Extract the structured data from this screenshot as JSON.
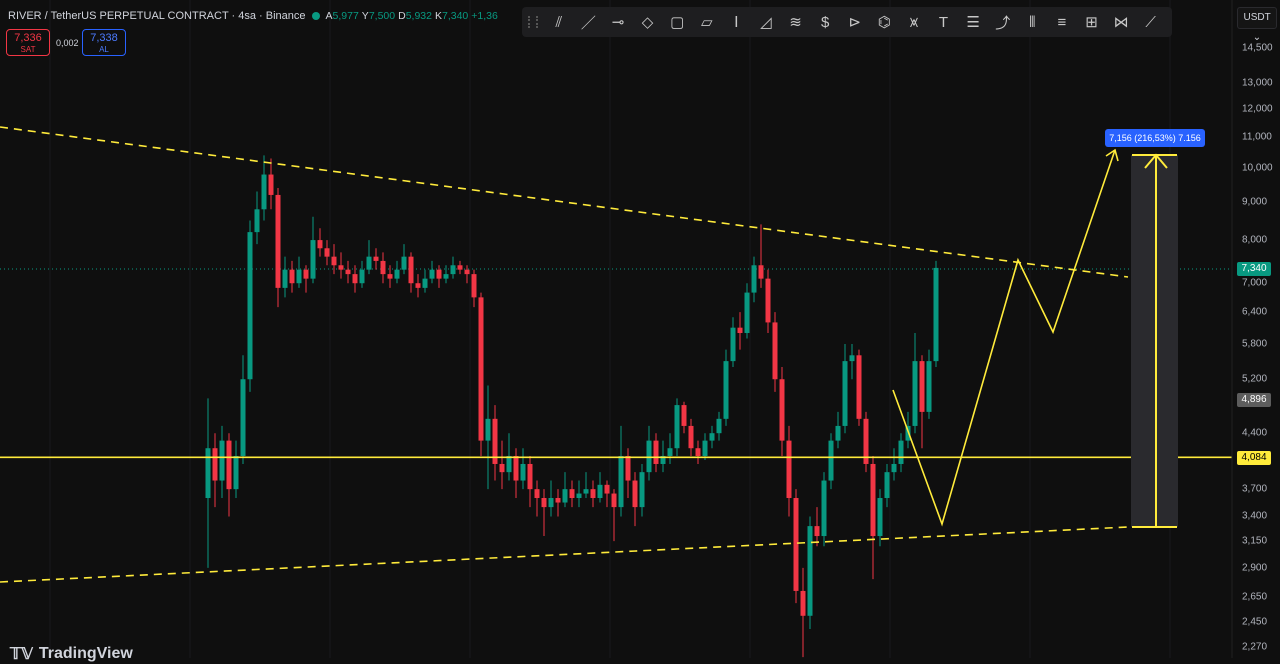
{
  "header": {
    "symbol": "RIVER / TetherUS PERPETUAL CONTRACT · 4sa · Binance",
    "ohlc": [
      {
        "k": "A",
        "v": "5,977"
      },
      {
        "k": "Y",
        "v": "7,500"
      },
      {
        "k": "D",
        "v": "5,932"
      },
      {
        "k": "K",
        "v": "7,340"
      }
    ],
    "change": "+1,36",
    "sell": {
      "price": "7,336",
      "label": "SAT"
    },
    "spread": "0,002",
    "buy": {
      "price": "7,338",
      "label": "AL"
    }
  },
  "toolbar": {
    "icons": [
      "trend-line-pair-icon",
      "trend-line-icon",
      "horizontal-ray-icon",
      "rotated-rectangle-icon",
      "rectangle-icon",
      "parallel-channel-icon",
      "price-range-icon",
      "triangle-icon",
      "fib-channel-icon",
      "price-label-icon",
      "pitchfork-icon",
      "path-icon",
      "head-shoulders-icon",
      "text-icon",
      "fib-retracement-icon",
      "polyline-arrow-icon",
      "bars-pattern-icon",
      "long-position-icon",
      "date-price-range-icon",
      "xabcd-pattern-icon",
      "brush-icon"
    ],
    "glyphs": [
      "⫽",
      "／",
      "⊸",
      "◇",
      "▢",
      "▱",
      "Ⅰ",
      "◿",
      "≋",
      "$",
      "⊳",
      "⌬",
      "⩙",
      "T",
      "☰",
      "⤴",
      "⦀",
      "≡",
      "⊞",
      "⋈",
      "⟋"
    ]
  },
  "price_axis": {
    "currency": "USDT",
    "ticks": [
      "14,500",
      "13,000",
      "12,000",
      "11,000",
      "10,000",
      "9,000",
      "8,000",
      "7,000",
      "6,400",
      "5,800",
      "5,200",
      "4,400",
      "3,700",
      "3,400",
      "3,150",
      "2,900",
      "2,650",
      "2,450",
      "2,270"
    ],
    "last_price": "7,340",
    "crosshair_price": "4,896",
    "line_price": "4,084"
  },
  "colors": {
    "up": "#089981",
    "down": "#f23645",
    "drawing": "#ffeb3b",
    "measure": "#2962ff",
    "background": "#0f0f0f"
  },
  "measure_label": "7,156 (216,53%) 7.156",
  "logo": "TradingView",
  "chart_data": {
    "type": "candlestick",
    "scale": "log",
    "ylim": [
      2200,
      15000
    ],
    "grid": true,
    "horizontal_line": 4084,
    "candles_ohlc": [
      [
        3600,
        4900,
        2900,
        4200
      ],
      [
        4200,
        4400,
        3500,
        3800
      ],
      [
        3800,
        4500,
        3600,
        4300
      ],
      [
        4300,
        4400,
        3400,
        3700
      ],
      [
        3700,
        4300,
        3600,
        4100
      ],
      [
        4100,
        5600,
        4000,
        5200
      ],
      [
        5200,
        8500,
        5000,
        8200
      ],
      [
        8200,
        9300,
        7900,
        8800
      ],
      [
        8800,
        10400,
        8500,
        9800
      ],
      [
        9800,
        10300,
        8800,
        9200
      ],
      [
        9200,
        9400,
        6500,
        6900
      ],
      [
        6900,
        7600,
        6700,
        7300
      ],
      [
        7300,
        7500,
        6800,
        7000
      ],
      [
        7000,
        7600,
        6900,
        7300
      ],
      [
        7300,
        7400,
        6800,
        7100
      ],
      [
        7100,
        8600,
        7000,
        8000
      ],
      [
        8000,
        8300,
        7600,
        7800
      ],
      [
        7800,
        8000,
        7400,
        7600
      ],
      [
        7600,
        7900,
        7200,
        7400
      ],
      [
        7400,
        7700,
        7100,
        7300
      ],
      [
        7300,
        7500,
        7000,
        7200
      ],
      [
        7200,
        7400,
        6800,
        7000
      ],
      [
        7000,
        7500,
        6900,
        7300
      ],
      [
        7300,
        8000,
        7200,
        7600
      ],
      [
        7600,
        7800,
        7300,
        7500
      ],
      [
        7500,
        7700,
        7000,
        7200
      ],
      [
        7200,
        7400,
        6900,
        7100
      ],
      [
        7100,
        7500,
        7000,
        7300
      ],
      [
        7300,
        7900,
        7200,
        7600
      ],
      [
        7600,
        7700,
        6800,
        7000
      ],
      [
        7000,
        7200,
        6700,
        6900
      ],
      [
        6900,
        7300,
        6800,
        7100
      ],
      [
        7100,
        7500,
        7000,
        7300
      ],
      [
        7300,
        7400,
        6900,
        7100
      ],
      [
        7100,
        7400,
        7000,
        7200
      ],
      [
        7200,
        7600,
        7100,
        7400
      ],
      [
        7400,
        7500,
        7200,
        7300
      ],
      [
        7300,
        7400,
        7000,
        7200
      ],
      [
        7200,
        7300,
        6500,
        6700
      ],
      [
        6700,
        6800,
        4100,
        4300
      ],
      [
        4300,
        5100,
        3700,
        4600
      ],
      [
        4600,
        4800,
        3800,
        4000
      ],
      [
        4000,
        4300,
        3700,
        3900
      ],
      [
        3900,
        4400,
        3800,
        4100
      ],
      [
        4100,
        4200,
        3600,
        3800
      ],
      [
        3800,
        4200,
        3700,
        4000
      ],
      [
        4000,
        4100,
        3500,
        3700
      ],
      [
        3700,
        3800,
        3400,
        3600
      ],
      [
        3600,
        3700,
        3200,
        3500
      ],
      [
        3500,
        3800,
        3400,
        3600
      ],
      [
        3600,
        3700,
        3400,
        3550
      ],
      [
        3550,
        3900,
        3500,
        3700
      ],
      [
        3700,
        3800,
        3500,
        3600
      ],
      [
        3600,
        3800,
        3500,
        3650
      ],
      [
        3650,
        3900,
        3600,
        3700
      ],
      [
        3700,
        3800,
        3500,
        3600
      ],
      [
        3600,
        3900,
        3550,
        3750
      ],
      [
        3750,
        3800,
        3500,
        3650
      ],
      [
        3650,
        3700,
        3150,
        3500
      ],
      [
        3500,
        4500,
        3400,
        4100
      ],
      [
        4100,
        4200,
        3600,
        3800
      ],
      [
        3800,
        3900,
        3300,
        3500
      ],
      [
        3500,
        4000,
        3400,
        3900
      ],
      [
        3900,
        4500,
        3800,
        4300
      ],
      [
        4300,
        4400,
        3900,
        4000
      ],
      [
        4000,
        4300,
        3900,
        4100
      ],
      [
        4100,
        4400,
        4000,
        4200
      ],
      [
        4200,
        4900,
        4100,
        4800
      ],
      [
        4800,
        4850,
        4400,
        4500
      ],
      [
        4500,
        4600,
        4100,
        4200
      ],
      [
        4200,
        4300,
        4000,
        4100
      ],
      [
        4100,
        4400,
        4050,
        4300
      ],
      [
        4300,
        4500,
        4200,
        4400
      ],
      [
        4400,
        4700,
        4300,
        4600
      ],
      [
        4600,
        5700,
        4500,
        5500
      ],
      [
        5500,
        6300,
        5400,
        6100
      ],
      [
        6100,
        6400,
        5700,
        6000
      ],
      [
        6000,
        7000,
        5900,
        6800
      ],
      [
        6800,
        7600,
        6600,
        7400
      ],
      [
        7400,
        8400,
        6900,
        7100
      ],
      [
        7100,
        7300,
        6000,
        6200
      ],
      [
        6200,
        6400,
        5000,
        5200
      ],
      [
        5200,
        5400,
        4100,
        4300
      ],
      [
        4300,
        4500,
        3400,
        3600
      ],
      [
        3600,
        3700,
        2600,
        2700
      ],
      [
        2700,
        2900,
        2200,
        2500
      ],
      [
        2500,
        3400,
        2400,
        3300
      ],
      [
        3300,
        3500,
        3100,
        3200
      ],
      [
        3200,
        3900,
        3100,
        3800
      ],
      [
        3800,
        4400,
        3700,
        4300
      ],
      [
        4300,
        4700,
        4200,
        4500
      ],
      [
        4500,
        5800,
        4400,
        5500
      ],
      [
        5500,
        5800,
        5200,
        5600
      ],
      [
        5600,
        5700,
        4500,
        4600
      ],
      [
        4600,
        4700,
        3900,
        4000
      ],
      [
        4000,
        4100,
        2800,
        3200
      ],
      [
        3200,
        3700,
        3100,
        3600
      ],
      [
        3600,
        4000,
        3500,
        3900
      ],
      [
        3900,
        4200,
        3800,
        4000
      ],
      [
        4000,
        4400,
        3900,
        4300
      ],
      [
        4300,
        4700,
        4200,
        4500
      ],
      [
        4500,
        6000,
        4400,
        5500
      ],
      [
        5500,
        5600,
        4200,
        4700
      ],
      [
        4700,
        5700,
        4600,
        5500
      ],
      [
        5500,
        7500,
        5400,
        7340
      ]
    ]
  }
}
